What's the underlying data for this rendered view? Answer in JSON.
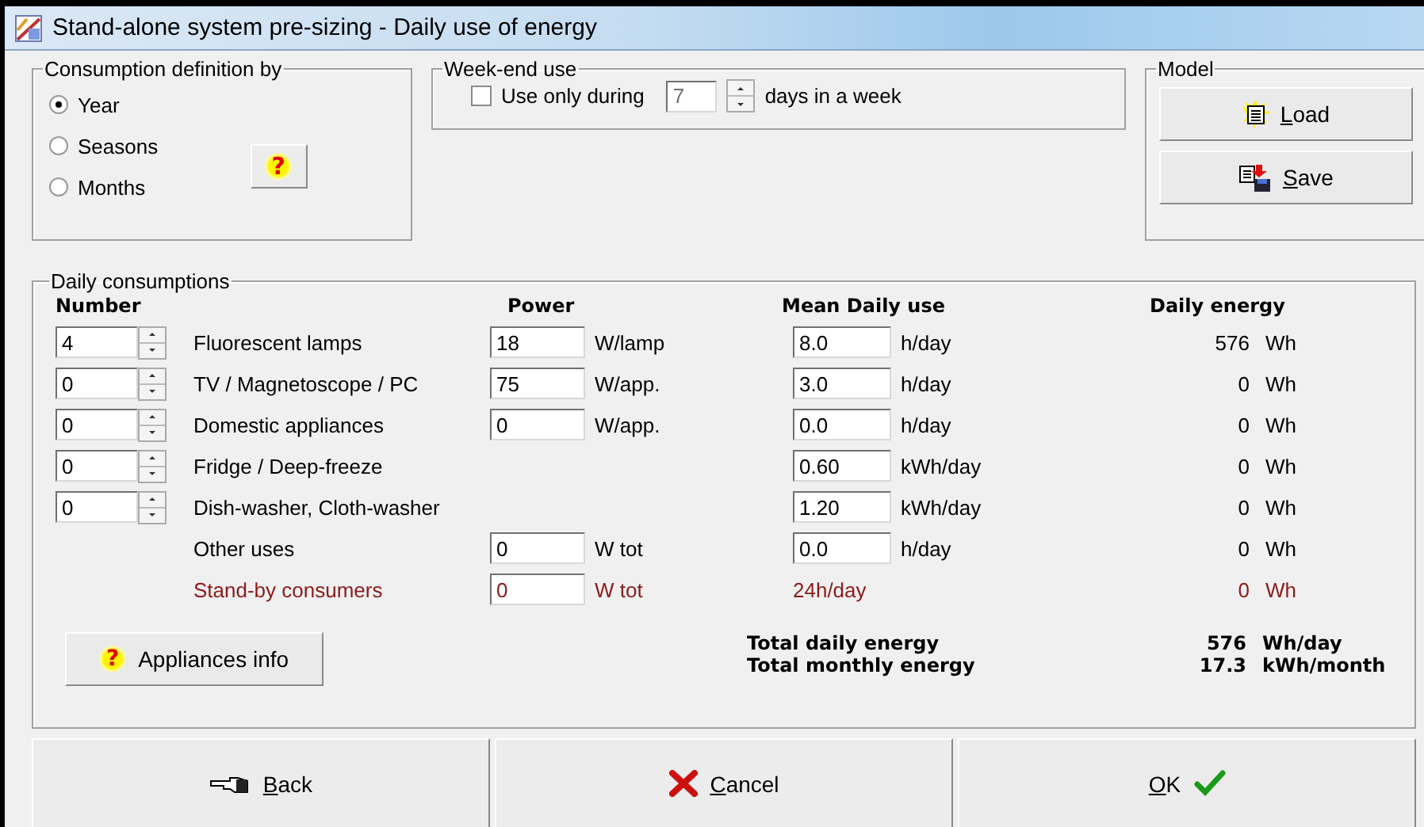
{
  "window": {
    "title": "Stand-alone system pre-sizing  -  Daily use of energy"
  },
  "consumption_definition": {
    "title": "Consumption definition by",
    "help": "?",
    "options": [
      {
        "label": "Year",
        "selected": true
      },
      {
        "label": "Seasons",
        "selected": false
      },
      {
        "label": "Months",
        "selected": false
      }
    ]
  },
  "week_end_use": {
    "title": "Week-end use",
    "checkbox": {
      "label": "Use only during",
      "checked": false
    },
    "days": {
      "value": "7",
      "disabled": true
    },
    "suffix": "days in a week"
  },
  "model": {
    "title": "Model",
    "buttons": [
      {
        "kind": "load",
        "label": "Load"
      },
      {
        "kind": "save",
        "label": "Save"
      }
    ]
  },
  "daily_consumptions": {
    "title": "Daily consumptions",
    "headers": [
      "Number",
      "Power",
      "Mean Daily use",
      "Daily energy"
    ],
    "rows": [
      {
        "kind": "appliance",
        "number": "4",
        "name": "Fluorescent lamps",
        "power": "18",
        "power_unit": "W/lamp",
        "use": "8.0",
        "use_unit": "h/day",
        "energy": "576",
        "energy_unit": "Wh"
      },
      {
        "kind": "appliance",
        "number": "0",
        "name": "TV / Magnetoscope / PC",
        "power": "75",
        "power_unit": "W/app.",
        "use": "3.0",
        "use_unit": "h/day",
        "energy": "0",
        "energy_unit": "Wh"
      },
      {
        "kind": "appliance",
        "number": "0",
        "name": "Domestic appliances",
        "power": "0",
        "power_unit": "W/app.",
        "use": "0.0",
        "use_unit": "h/day",
        "energy": "0",
        "energy_unit": "Wh"
      },
      {
        "kind": "appliance",
        "number": "0",
        "name": "Fridge / Deep-freeze",
        "use": "0.60",
        "use_unit": "kWh/day",
        "energy": "0",
        "energy_unit": "Wh"
      },
      {
        "kind": "appliance",
        "number": "0",
        "name": "Dish-washer,  Cloth-washer",
        "use": "1.20",
        "use_unit": "kWh/day",
        "energy": "0",
        "energy_unit": "Wh"
      },
      {
        "kind": "other",
        "name": "Other uses",
        "power": "0",
        "power_unit": "W tot",
        "use": "0.0",
        "use_unit": "h/day",
        "energy": "0",
        "energy_unit": "Wh"
      },
      {
        "kind": "standby",
        "name": "Stand-by consumers",
        "power": "0",
        "power_unit": "W tot",
        "use_text": "24h/day",
        "energy": "0",
        "energy_unit": "Wh"
      }
    ],
    "info_button": {
      "icon": "?",
      "label": "Appliances info"
    },
    "totals": [
      {
        "label": "Total daily energy",
        "value": "576",
        "unit": "Wh/day"
      },
      {
        "label": "Total monthly energy",
        "value": "17.3",
        "unit": "kWh/month"
      }
    ]
  },
  "footer_buttons": [
    {
      "kind": "back",
      "label": "Back"
    },
    {
      "kind": "cancel",
      "label": "Cancel"
    },
    {
      "kind": "ok",
      "label": "OK"
    }
  ]
}
